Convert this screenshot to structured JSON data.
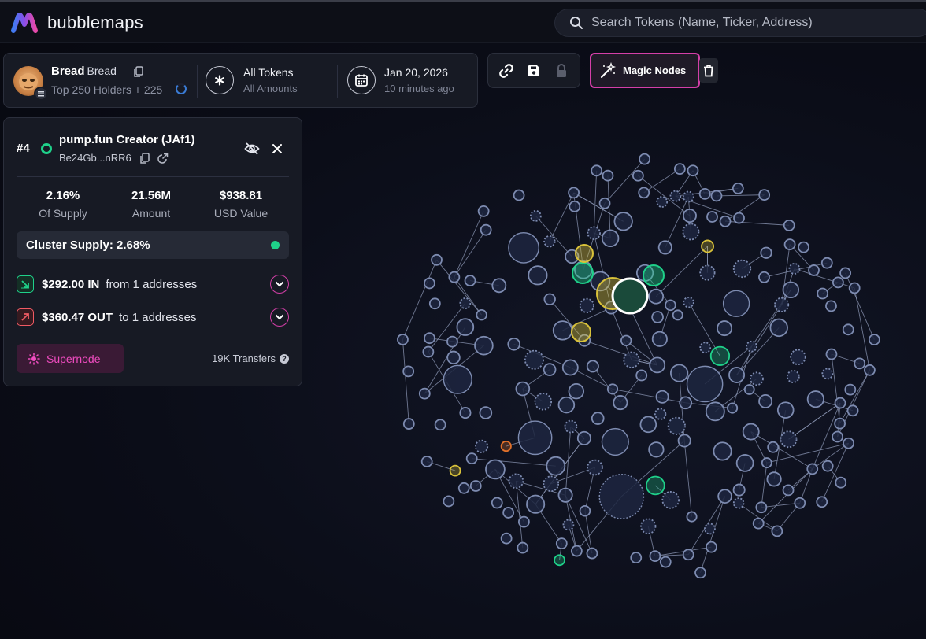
{
  "app": {
    "name": "bubblemaps"
  },
  "search": {
    "placeholder": "Search Tokens (Name, Ticker, Address)"
  },
  "token": {
    "name": "Bread",
    "ticker": "Bread",
    "holders": "Top 250 Holders + 225",
    "filter_title": "All Tokens",
    "filter_sub": "All Amounts",
    "date_title": "Jan 20, 2026",
    "date_sub": "10 minutes ago"
  },
  "toolbar": {
    "icons": [
      "link-icon",
      "save-icon",
      "lock-icon"
    ],
    "magic_label": "Magic Nodes"
  },
  "panel": {
    "rank": "#4",
    "title": "pump.fun Creator (JAf1)",
    "address": "Be24Gb...nRR6",
    "stats": [
      {
        "value": "2.16%",
        "label": "Of Supply"
      },
      {
        "value": "21.56M",
        "label": "Amount"
      },
      {
        "value": "$938.81",
        "label": "USD Value"
      }
    ],
    "cluster": "Cluster Supply: 2.68%",
    "flow_in": {
      "amount": "$292.00 IN",
      "text": "from 1 addresses"
    },
    "flow_out": {
      "amount": "$360.47 OUT",
      "text": "to 1 addresses"
    },
    "supernode": "Supernode",
    "transfers": "19K Transfers"
  },
  "colors": {
    "accent": "#d43fa8",
    "green": "#1fd18a",
    "yellow": "#d9c23a",
    "orange": "#e0702a",
    "bubble": "#1d2640",
    "bubble_stroke": "#7d8bb0"
  }
}
